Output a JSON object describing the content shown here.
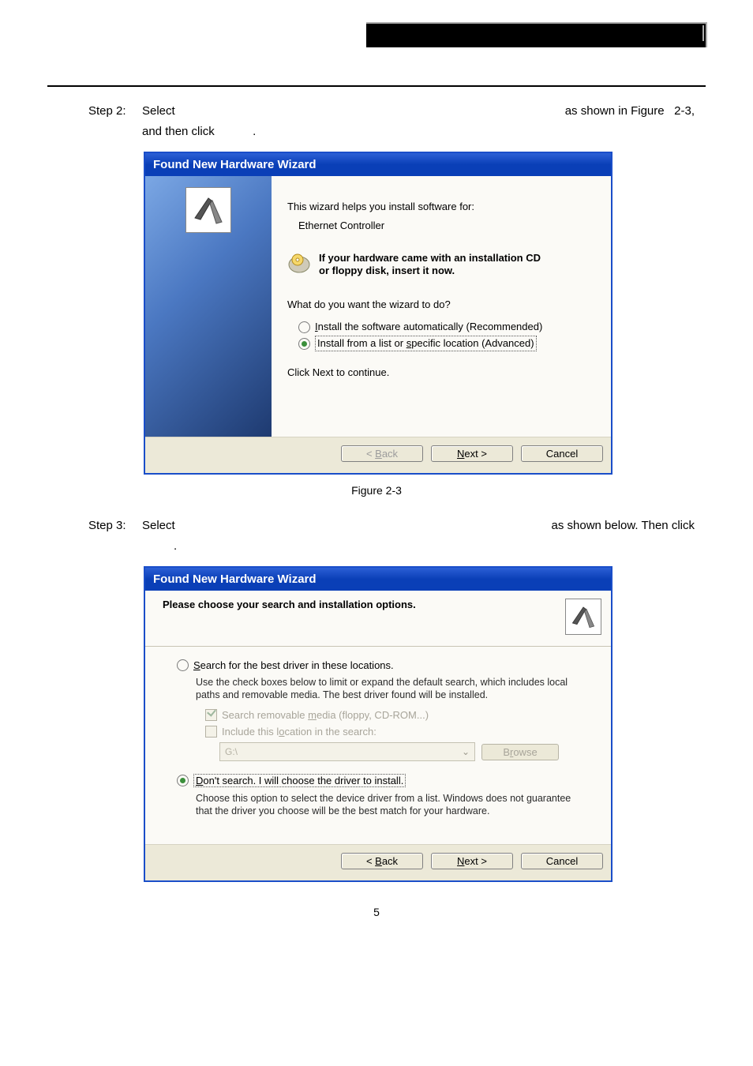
{
  "step2": {
    "label": "Step 2:",
    "select_word": "Select",
    "middle": "",
    "shown": "as shown in Figure",
    "fig": "2-3,",
    "line2a": "and then click",
    "line2b": "."
  },
  "dialog1": {
    "title": "Found New Hardware Wizard",
    "intro": "This wizard helps you install software for:",
    "device": "Ethernet Controller",
    "cd1": "If your hardware came with an installation CD",
    "cd2": "or floppy disk, insert it now.",
    "question": "What do you want the wizard to do?",
    "opt_auto_pre": "I",
    "opt_auto": "nstall the software automatically (Recommended)",
    "opt_list": "Install from a list or ",
    "opt_list_u": "s",
    "opt_list_rest": "pecific location (Advanced)",
    "continue": "Click Next to continue.",
    "back_u": "B",
    "back": "< ",
    "back_rest": "ack",
    "next_u": "N",
    "next_rest": "ext >",
    "cancel": "Cancel"
  },
  "figure23": "Figure 2-3",
  "step3": {
    "label": "Step 3:",
    "select_word": "Select",
    "shown": "as shown below. Then click",
    "dot": "."
  },
  "dialog2": {
    "title": "Found New Hardware Wizard",
    "header": "Please choose your search and installation options.",
    "opt1_u": "S",
    "opt1": "earch for the best driver in these locations.",
    "opt1_desc": "Use the check boxes below to limit or expand the default search, which includes local paths and removable media. The best driver found will be installed.",
    "chk1_pre": "Search removable ",
    "chk1_u": "m",
    "chk1_rest": "edia (floppy, CD-ROM...)",
    "chk2_pre": "Include this l",
    "chk2_u": "o",
    "chk2_rest": "cation in the search:",
    "path": "G:\\",
    "browse_u": "r",
    "browse_pre": "B",
    "browse_rest": "owse",
    "opt2_u": "D",
    "opt2": "on't search. I will choose the driver to install.",
    "opt2_desc": "Choose this option to select the device driver from a list.  Windows does not guarantee that the driver you choose will be the best match for your hardware.",
    "back_u": "B",
    "back": "< ",
    "back_rest": "ack",
    "next_u": "N",
    "next_rest": "ext >",
    "cancel": "Cancel"
  },
  "pagenum": "5"
}
